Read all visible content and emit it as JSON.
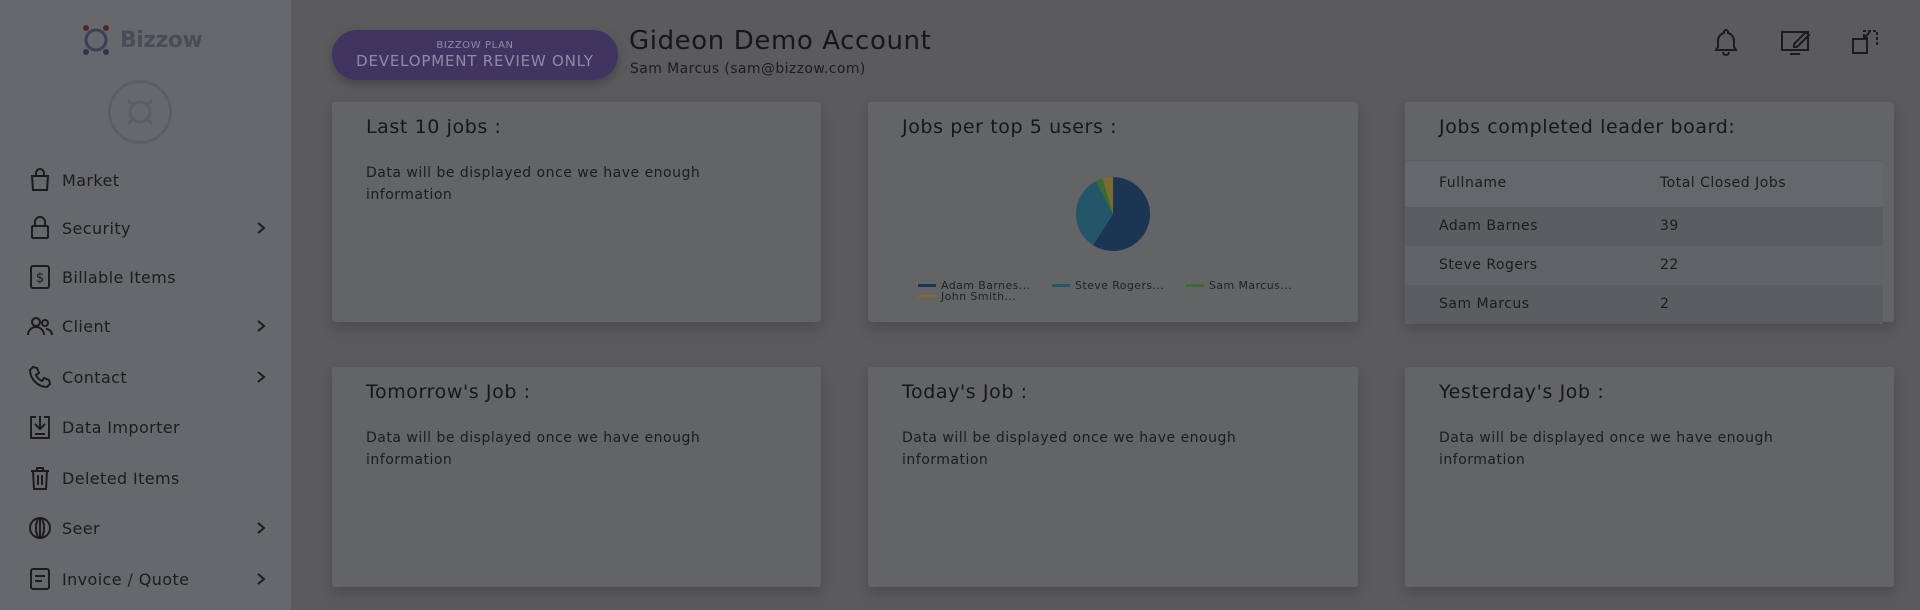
{
  "brand": {
    "name": "Bizzow"
  },
  "sidebar": {
    "items": [
      {
        "label": "Market",
        "icon": "shopping-bag-icon",
        "has_submenu": false
      },
      {
        "label": "Security",
        "icon": "lock-icon",
        "has_submenu": true
      },
      {
        "label": "Billable Items",
        "icon": "dollar-doc-icon",
        "has_submenu": false
      },
      {
        "label": "Client",
        "icon": "users-icon",
        "has_submenu": true
      },
      {
        "label": "Contact",
        "icon": "phone-icon",
        "has_submenu": true
      },
      {
        "label": "Data Importer",
        "icon": "import-icon",
        "has_submenu": false
      },
      {
        "label": "Deleted Items",
        "icon": "trash-icon",
        "has_submenu": false
      },
      {
        "label": "Seer",
        "icon": "globe-icon",
        "has_submenu": true
      },
      {
        "label": "Invoice / Quote",
        "icon": "invoice-icon",
        "has_submenu": true
      }
    ]
  },
  "header": {
    "plan_small": "BIZZOW PLAN",
    "plan_main": "DEVELOPMENT REVIEW ONLY",
    "account_title": "Gideon Demo Account",
    "account_sub": "Sam Marcus (sam@bizzow.com)",
    "icons": [
      "bell-icon",
      "edit-screen-icon",
      "switch-account-icon"
    ]
  },
  "cards": {
    "last10": {
      "title": "Last 10 jobs :",
      "body": "Data will be displayed once we have enough information"
    },
    "top5": {
      "title": "Jobs per top 5 users :"
    },
    "leaderboard": {
      "title": "Jobs completed leader board:",
      "columns": [
        "Fullname",
        "Total Closed Jobs"
      ],
      "rows": [
        {
          "name": "Adam Barnes",
          "total": "39"
        },
        {
          "name": "Steve Rogers",
          "total": "22"
        },
        {
          "name": "Sam Marcus",
          "total": "2"
        }
      ]
    },
    "tomorrow": {
      "title": "Tomorrow's Job :",
      "body": "Data will be displayed once we have enough information"
    },
    "today": {
      "title": "Today's Job :",
      "body": "Data will be displayed once we have enough information"
    },
    "yesterday": {
      "title": "Yesterday's Job :",
      "body": "Data will be displayed once we have enough information"
    }
  },
  "chart_data": {
    "type": "pie",
    "title": "Jobs per top 5 users :",
    "categories": [
      "Adam Barnes...",
      "Steve Rogers...",
      "Sam Marcus...",
      "John Smith..."
    ],
    "values": [
      39,
      22,
      2,
      3
    ],
    "colors": [
      "#1c3552",
      "#24566a",
      "#3d6a2f",
      "#7a6a33"
    ]
  },
  "colors": {
    "overlay_bg": "#5b5b5e",
    "plan_pill": "#3f3560"
  }
}
